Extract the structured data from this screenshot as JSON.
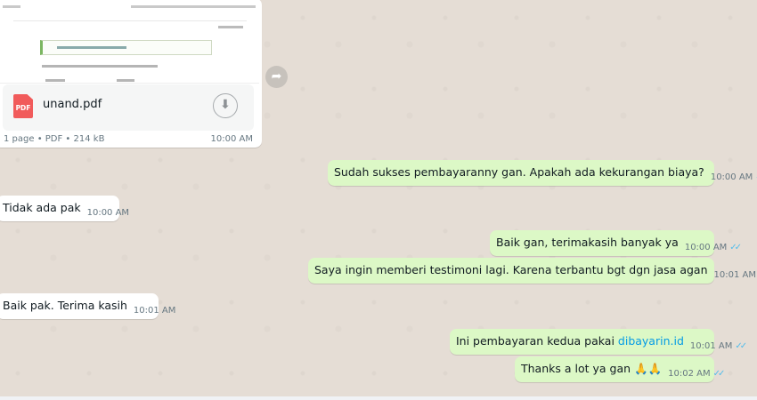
{
  "document": {
    "file_name": "unand.pdf",
    "file_type_badge": "PDF",
    "info": "1 page • PDF • 214 kB",
    "time": "10:00 AM"
  },
  "icons": {
    "forward": "forward-arrow-icon",
    "download": "download-icon",
    "read_receipt": "double-check-icon"
  },
  "colors": {
    "outgoing_bubble": "#dcf8c6",
    "incoming_bubble": "#ffffff",
    "chat_background": "#e5ddd5",
    "read_ticks": "#53bdeb",
    "link": "#039be5",
    "pdf_badge": "#f15b5b"
  },
  "messages": [
    {
      "direction": "out",
      "text": "Sudah sukses pembayaranny gan. Apakah ada kekurangan biaya?",
      "time": "10:00 AM",
      "ticks": "✓✓"
    },
    {
      "direction": "in",
      "text": "Tidak ada pak",
      "time": "10:00 AM"
    },
    {
      "direction": "out",
      "text": "Baik gan, terimakasih banyak ya",
      "time": "10:00 AM",
      "ticks": "✓✓"
    },
    {
      "direction": "out",
      "text": "Saya ingin memberi testimoni lagi. Karena terbantu bgt dgn jasa agan",
      "time": "10:01 AM",
      "ticks": "✓✓"
    },
    {
      "direction": "in",
      "text": "Baik pak. Terima kasih",
      "time": "10:01 AM"
    },
    {
      "direction": "out",
      "text_before_link": "Ini pembayaran kedua pakai ",
      "link": "dibayarin.id",
      "time": "10:01 AM",
      "ticks": "✓✓"
    },
    {
      "direction": "out",
      "text": "Thanks a lot ya gan 🙏🙏",
      "time": "10:02 AM",
      "ticks": "✓✓"
    }
  ]
}
